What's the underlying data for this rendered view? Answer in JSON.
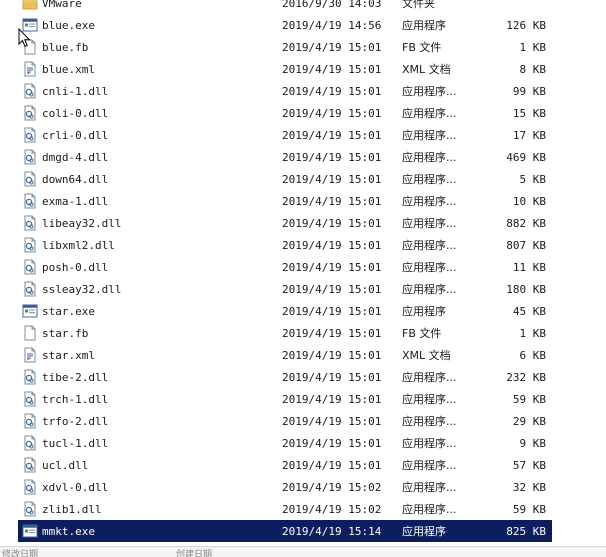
{
  "files": [
    {
      "name": "VMware",
      "date": "2016/9/30 14:03",
      "type": "文件夹",
      "size": "",
      "icon": "folder-icon"
    },
    {
      "name": "blue.exe",
      "date": "2019/4/19 14:56",
      "type": "应用程序",
      "size": "126 KB",
      "icon": "exe-icon"
    },
    {
      "name": "blue.fb",
      "date": "2019/4/19 15:01",
      "type": "FB 文件",
      "size": "1 KB",
      "icon": "file-icon"
    },
    {
      "name": "blue.xml",
      "date": "2019/4/19 15:01",
      "type": "XML 文档",
      "size": "8 KB",
      "icon": "xml-icon"
    },
    {
      "name": "cnli-1.dll",
      "date": "2019/4/19 15:01",
      "type": "应用程序...",
      "size": "99 KB",
      "icon": "dll-icon"
    },
    {
      "name": "coli-0.dll",
      "date": "2019/4/19 15:01",
      "type": "应用程序...",
      "size": "15 KB",
      "icon": "dll-icon"
    },
    {
      "name": "crli-0.dll",
      "date": "2019/4/19 15:01",
      "type": "应用程序...",
      "size": "17 KB",
      "icon": "dll-icon"
    },
    {
      "name": "dmgd-4.dll",
      "date": "2019/4/19 15:01",
      "type": "应用程序...",
      "size": "469 KB",
      "icon": "dll-icon"
    },
    {
      "name": "down64.dll",
      "date": "2019/4/19 15:01",
      "type": "应用程序...",
      "size": "5 KB",
      "icon": "dll-icon"
    },
    {
      "name": "exma-1.dll",
      "date": "2019/4/19 15:01",
      "type": "应用程序...",
      "size": "10 KB",
      "icon": "dll-icon"
    },
    {
      "name": "libeay32.dll",
      "date": "2019/4/19 15:01",
      "type": "应用程序...",
      "size": "882 KB",
      "icon": "dll-icon"
    },
    {
      "name": "libxml2.dll",
      "date": "2019/4/19 15:01",
      "type": "应用程序...",
      "size": "807 KB",
      "icon": "dll-icon"
    },
    {
      "name": "posh-0.dll",
      "date": "2019/4/19 15:01",
      "type": "应用程序...",
      "size": "11 KB",
      "icon": "dll-icon"
    },
    {
      "name": "ssleay32.dll",
      "date": "2019/4/19 15:01",
      "type": "应用程序...",
      "size": "180 KB",
      "icon": "dll-icon"
    },
    {
      "name": "star.exe",
      "date": "2019/4/19 15:01",
      "type": "应用程序",
      "size": "45 KB",
      "icon": "exe-icon"
    },
    {
      "name": "star.fb",
      "date": "2019/4/19 15:01",
      "type": "FB 文件",
      "size": "1 KB",
      "icon": "file-icon"
    },
    {
      "name": "star.xml",
      "date": "2019/4/19 15:01",
      "type": "XML 文档",
      "size": "6 KB",
      "icon": "xml-icon"
    },
    {
      "name": "tibe-2.dll",
      "date": "2019/4/19 15:01",
      "type": "应用程序...",
      "size": "232 KB",
      "icon": "dll-icon"
    },
    {
      "name": "trch-1.dll",
      "date": "2019/4/19 15:01",
      "type": "应用程序...",
      "size": "59 KB",
      "icon": "dll-icon"
    },
    {
      "name": "trfo-2.dll",
      "date": "2019/4/19 15:01",
      "type": "应用程序...",
      "size": "29 KB",
      "icon": "dll-icon"
    },
    {
      "name": "tucl-1.dll",
      "date": "2019/4/19 15:01",
      "type": "应用程序...",
      "size": "9 KB",
      "icon": "dll-icon"
    },
    {
      "name": "ucl.dll",
      "date": "2019/4/19 15:01",
      "type": "应用程序...",
      "size": "57 KB",
      "icon": "dll-icon"
    },
    {
      "name": "xdvl-0.dll",
      "date": "2019/4/19 15:02",
      "type": "应用程序...",
      "size": "32 KB",
      "icon": "dll-icon"
    },
    {
      "name": "zlib1.dll",
      "date": "2019/4/19 15:02",
      "type": "应用程序...",
      "size": "59 KB",
      "icon": "dll-icon"
    },
    {
      "name": "mmkt.exe",
      "date": "2019/4/19 15:14",
      "type": "应用程序",
      "size": "825 KB",
      "icon": "exe-icon",
      "selected": true
    }
  ],
  "colors": {
    "selection_background": "#0b1f5e",
    "selection_text": "#ffffff",
    "folder": "#e8c15a"
  },
  "status": {
    "modified_label": "修改日期",
    "created_label": "创建日期"
  }
}
